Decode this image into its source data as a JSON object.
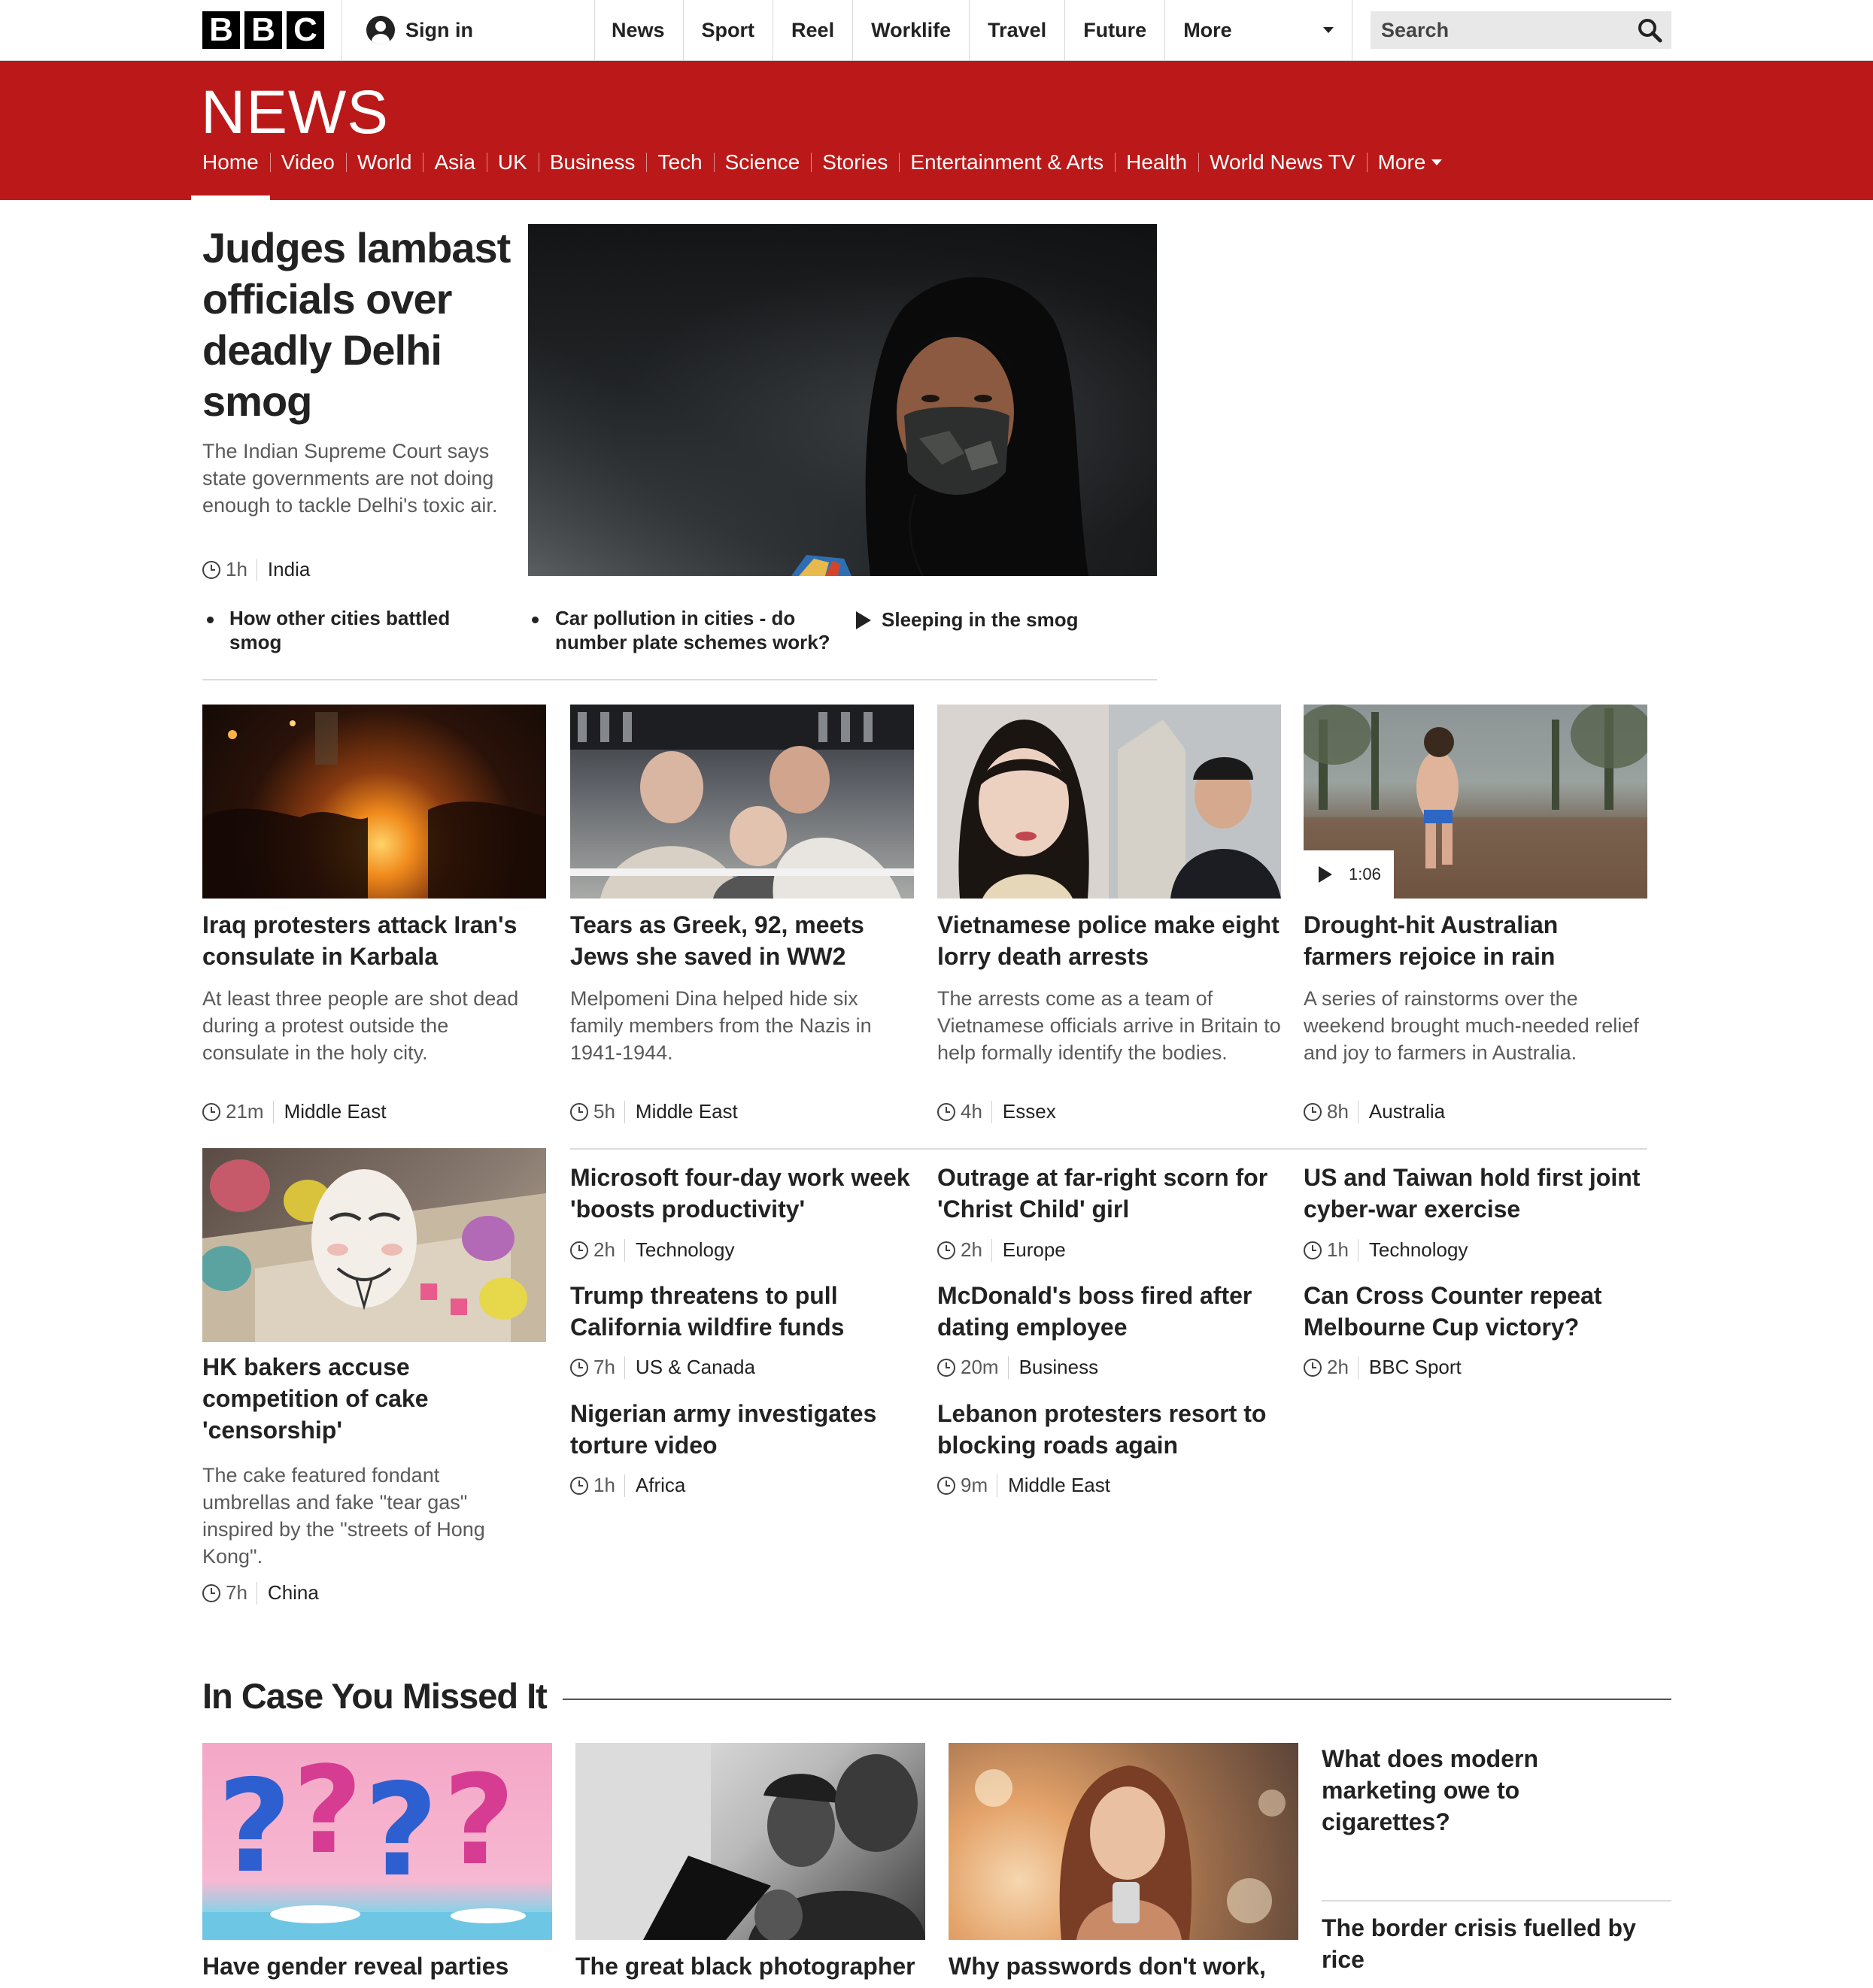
{
  "masthead": {
    "logo_letters": [
      "B",
      "B",
      "C"
    ],
    "sign_in": "Sign in",
    "nav": [
      "News",
      "Sport",
      "Reel",
      "Worklife",
      "Travel",
      "Future"
    ],
    "nav_more": "More",
    "search_placeholder": "Search"
  },
  "news_bar": {
    "title": "NEWS",
    "tabs": [
      "Home",
      "Video",
      "World",
      "Asia",
      "UK",
      "Business",
      "Tech",
      "Science",
      "Stories",
      "Entertainment & Arts",
      "Health",
      "World News TV"
    ],
    "more": "More",
    "active_tab": "Home"
  },
  "lead": {
    "headline": "Judges lambast officials over deadly Delhi smog",
    "summary": "The Indian Supreme Court says state governments are not doing enough to tackle Delhi's toxic air.",
    "time": "1h",
    "section": "India",
    "related": [
      {
        "label": "How other cities battled smog",
        "type": "article"
      },
      {
        "label": "Car pollution in cities - do number plate schemes work?",
        "type": "article"
      },
      {
        "label": "Sleeping in the smog",
        "type": "video"
      }
    ]
  },
  "top_cards": [
    {
      "headline": "Iraq protesters attack Iran's consulate in Karbala",
      "summary": "At least three people are shot dead during a protest outside the consulate in the holy city.",
      "time": "21m",
      "section": "Middle East"
    },
    {
      "headline": "Tears as Greek, 92, meets Jews she saved in WW2",
      "summary": "Melpomeni Dina helped hide six family members from the Nazis in 1941-1944.",
      "time": "5h",
      "section": "Middle East"
    },
    {
      "headline": "Vietnamese police make eight lorry death arrests",
      "summary": "The arrests come as a team of Vietnamese officials arrive in Britain to help formally identify the bodies.",
      "time": "4h",
      "section": "Essex"
    },
    {
      "headline": "Drought-hit Australian farmers rejoice in rain",
      "summary": "A series of rainstorms over the weekend brought much-needed relief and joy to farmers in Australia.",
      "time": "8h",
      "section": "Australia",
      "video_duration": "1:06"
    }
  ],
  "hk_card": {
    "headline": "HK bakers accuse competition of cake 'censorship'",
    "summary": "The cake featured fondant umbrellas and fake \"tear gas\" inspired by the \"streets of Hong Kong\".",
    "time": "7h",
    "section": "China"
  },
  "text_stories": [
    {
      "headline": "Microsoft four-day work week 'boosts productivity'",
      "time": "2h",
      "section": "Technology"
    },
    {
      "headline": "Outrage at far-right scorn for 'Christ Child' girl",
      "time": "2h",
      "section": "Europe"
    },
    {
      "headline": "US and Taiwan hold first joint cyber-war exercise",
      "time": "1h",
      "section": "Technology"
    },
    {
      "headline": "Trump threatens to pull California wildfire funds",
      "time": "7h",
      "section": "US & Canada"
    },
    {
      "headline": "McDonald's boss fired after dating employee",
      "time": "20m",
      "section": "Business"
    },
    {
      "headline": "Can Cross Counter repeat Melbourne Cup victory?",
      "time": "2h",
      "section": "BBC Sport"
    },
    {
      "headline": "Nigerian army investigates torture video",
      "time": "1h",
      "section": "Africa"
    },
    {
      "headline": "Lebanon protesters resort to blocking roads again",
      "time": "9m",
      "section": "Middle East"
    }
  ],
  "missed": {
    "title": "In Case You Missed It",
    "cards": [
      {
        "headline": "Have gender reveal parties"
      },
      {
        "headline": "The great black photographer"
      },
      {
        "headline": "Why passwords don't work,"
      }
    ],
    "side": [
      {
        "headline": "What does modern marketing owe to cigarettes?"
      },
      {
        "headline": "The border crisis fuelled by rice"
      }
    ]
  },
  "colors": {
    "brand_red": "#bb1919",
    "text": "#222222",
    "muted": "#5a5a5a"
  }
}
